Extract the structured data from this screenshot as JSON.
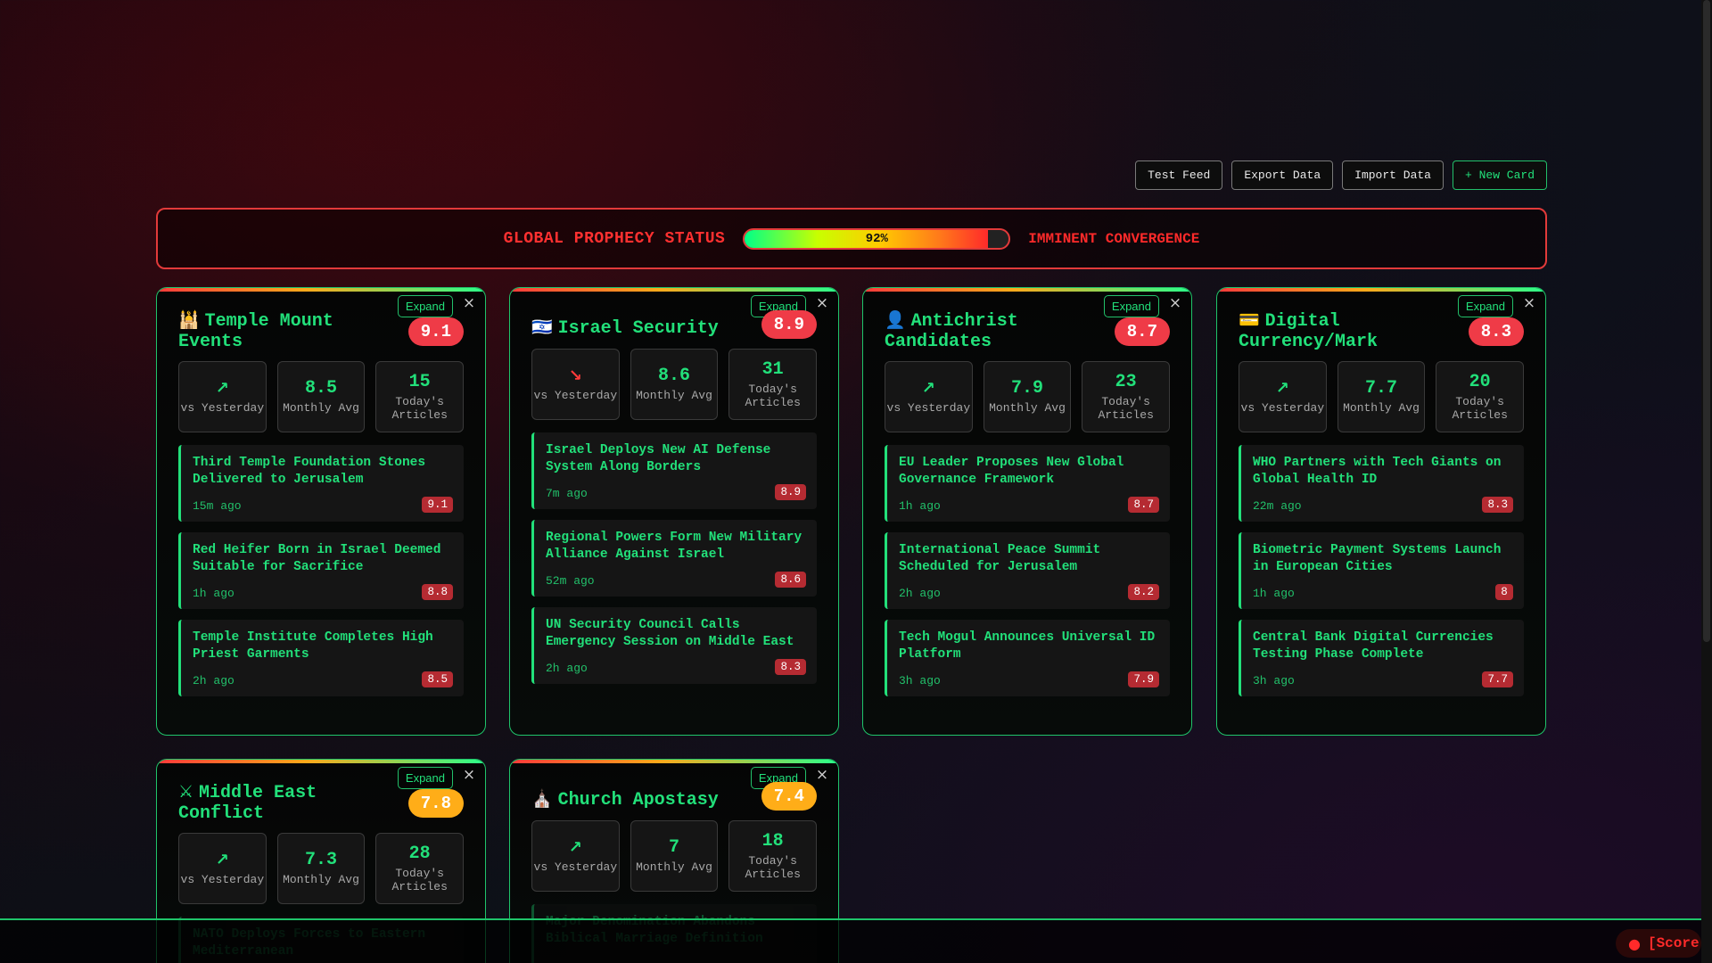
{
  "toolbar": {
    "test_feed": "Test Feed",
    "export_data": "Export Data",
    "import_data": "Import Data",
    "new_card": "+ New Card"
  },
  "status": {
    "label": "GLOBAL PROPHECY STATUS",
    "percent": 92,
    "percent_text": "92%",
    "state": "IMMINENT CONVERGENCE"
  },
  "common": {
    "expand": "Expand",
    "close": "×",
    "vs_yesterday": "vs Yesterday",
    "monthly_avg": "Monthly Avg",
    "todays_articles": "Today's Articles"
  },
  "cards": [
    {
      "emoji": "🕌",
      "title": "Temple Mount Events",
      "score": "9.1",
      "score_color": "red",
      "trend_icon": "↗",
      "trend": "up",
      "monthly_avg": "8.5",
      "todays_articles": "15",
      "articles": [
        {
          "title": "Third Temple Foundation Stones Delivered to Jerusalem",
          "time": "15m ago",
          "score": "9.1"
        },
        {
          "title": "Red Heifer Born in Israel Deemed Suitable for Sacrifice",
          "time": "1h ago",
          "score": "8.8"
        },
        {
          "title": "Temple Institute Completes High Priest Garments",
          "time": "2h ago",
          "score": "8.5"
        }
      ]
    },
    {
      "emoji": "🇮🇱",
      "title": "Israel Security",
      "score": "8.9",
      "score_color": "red",
      "trend_icon": "↘",
      "trend": "down",
      "monthly_avg": "8.6",
      "todays_articles": "31",
      "articles": [
        {
          "title": "Israel Deploys New AI Defense System Along Borders",
          "time": "7m ago",
          "score": "8.9"
        },
        {
          "title": "Regional Powers Form New Military Alliance Against Israel",
          "time": "52m ago",
          "score": "8.6"
        },
        {
          "title": "UN Security Council Calls Emergency Session on Middle East",
          "time": "2h ago",
          "score": "8.3"
        }
      ]
    },
    {
      "emoji": "👤",
      "title": "Antichrist Candidates",
      "score": "8.7",
      "score_color": "red",
      "trend_icon": "↗",
      "trend": "up",
      "monthly_avg": "7.9",
      "todays_articles": "23",
      "articles": [
        {
          "title": "EU Leader Proposes New Global Governance Framework",
          "time": "1h ago",
          "score": "8.7"
        },
        {
          "title": "International Peace Summit Scheduled for Jerusalem",
          "time": "2h ago",
          "score": "8.2"
        },
        {
          "title": "Tech Mogul Announces Universal ID Platform",
          "time": "3h ago",
          "score": "7.9"
        }
      ]
    },
    {
      "emoji": "💳",
      "title": "Digital Currency/Mark",
      "score": "8.3",
      "score_color": "red",
      "trend_icon": "↗",
      "trend": "up",
      "monthly_avg": "7.7",
      "todays_articles": "20",
      "articles": [
        {
          "title": "WHO Partners with Tech Giants on Global Health ID",
          "time": "22m ago",
          "score": "8.3"
        },
        {
          "title": "Biometric Payment Systems Launch in European Cities",
          "time": "1h ago",
          "score": "8"
        },
        {
          "title": "Central Bank Digital Currencies Testing Phase Complete",
          "time": "3h ago",
          "score": "7.7"
        }
      ]
    },
    {
      "emoji": "⚔",
      "title": "Middle East Conflict",
      "score": "7.8",
      "score_color": "orange",
      "trend_icon": "↗",
      "trend": "up",
      "monthly_avg": "7.3",
      "todays_articles": "28",
      "articles": [
        {
          "title": "NATO Deploys Forces to Eastern Mediterranean",
          "time": "",
          "score": ""
        }
      ]
    },
    {
      "emoji": "⛪",
      "title": "Church Apostasy",
      "score": "7.4",
      "score_color": "orange",
      "trend_icon": "↗",
      "trend": "up",
      "monthly_avg": "7",
      "todays_articles": "18",
      "articles": [
        {
          "title": "Major Denomination Abandons Biblical Marriage Definition",
          "time": "",
          "score": ""
        }
      ]
    }
  ],
  "ticker": {
    "badge": "[Score"
  }
}
